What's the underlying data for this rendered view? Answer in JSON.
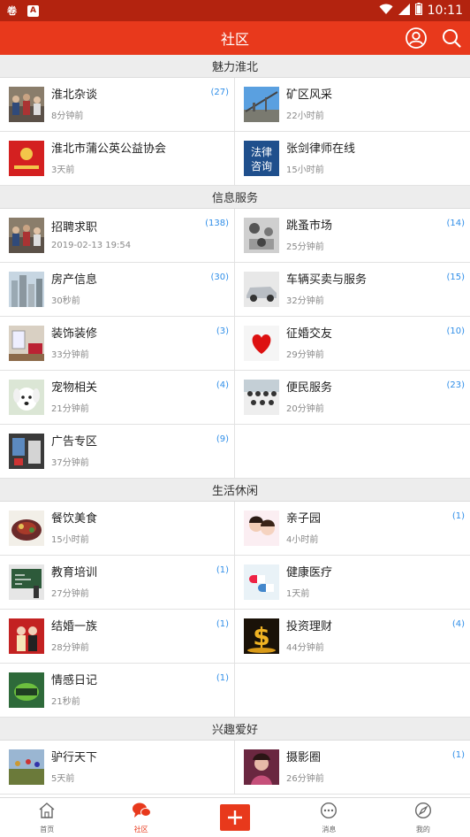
{
  "status_bar": {
    "time": "10:11",
    "app_icon_1": "卷",
    "app_icon_2": "A"
  },
  "app_bar": {
    "title": "社区"
  },
  "sections": [
    {
      "title": "魅力淮北",
      "items": [
        {
          "title": "淮北杂谈",
          "time": "8分钟前",
          "count": "(27)",
          "thumb": "crowd"
        },
        {
          "title": "矿区风采",
          "time": "22小时前",
          "count": "",
          "thumb": "sky"
        },
        {
          "title": "淮北市蒲公英公益协会",
          "time": "3天前",
          "count": "",
          "thumb": "redlogo"
        },
        {
          "title": "张剑律师在线",
          "time": "15小时前",
          "count": "",
          "thumb": "law"
        }
      ]
    },
    {
      "title": "信息服务",
      "items": [
        {
          "title": "招聘求职",
          "time": "2019-02-13 19:54",
          "count": "(138)",
          "thumb": "crowd"
        },
        {
          "title": "跳蚤市场",
          "time": "25分钟前",
          "count": "(14)",
          "thumb": "market"
        },
        {
          "title": "房产信息",
          "time": "30秒前",
          "count": "(30)",
          "thumb": "city"
        },
        {
          "title": "车辆买卖与服务",
          "time": "32分钟前",
          "count": "(15)",
          "thumb": "car"
        },
        {
          "title": "装饰装修",
          "time": "33分钟前",
          "count": "(3)",
          "thumb": "room"
        },
        {
          "title": "征婚交友",
          "time": "29分钟前",
          "count": "(10)",
          "thumb": "heart"
        },
        {
          "title": "宠物相关",
          "time": "21分钟前",
          "count": "(4)",
          "thumb": "dog"
        },
        {
          "title": "便民服务",
          "time": "20分钟前",
          "count": "(23)",
          "thumb": "group"
        },
        {
          "title": "广告专区",
          "time": "37分钟前",
          "count": "(9)",
          "thumb": "ad"
        }
      ]
    },
    {
      "title": "生活休闲",
      "items": [
        {
          "title": "餐饮美食",
          "time": "15小时前",
          "count": "",
          "thumb": "food"
        },
        {
          "title": "亲子园",
          "time": "4小时前",
          "count": "(1)",
          "thumb": "kids"
        },
        {
          "title": "教育培训",
          "time": "27分钟前",
          "count": "(1)",
          "thumb": "board"
        },
        {
          "title": "健康医疗",
          "time": "1天前",
          "count": "",
          "thumb": "pills"
        },
        {
          "title": "结婚一族",
          "time": "28分钟前",
          "count": "(1)",
          "thumb": "wedding"
        },
        {
          "title": "投资理财",
          "time": "44分钟前",
          "count": "(4)",
          "thumb": "gold"
        },
        {
          "title": "情感日记",
          "time": "21秒前",
          "count": "(1)",
          "thumb": "green"
        }
      ]
    },
    {
      "title": "兴趣爱好",
      "items": [
        {
          "title": "驴行天下",
          "time": "5天前",
          "count": "",
          "thumb": "hike"
        },
        {
          "title": "摄影圈",
          "time": "26分钟前",
          "count": "(1)",
          "thumb": "photo"
        }
      ]
    }
  ],
  "bottom_nav": [
    {
      "label": "首页",
      "icon": "home-icon"
    },
    {
      "label": "社区",
      "icon": "community-icon",
      "active": true
    },
    {
      "label": "",
      "icon": "plus-icon"
    },
    {
      "label": "消息",
      "icon": "message-icon"
    },
    {
      "label": "我的",
      "icon": "compass-icon"
    }
  ],
  "colors": {
    "accent": "#e8391c",
    "status_bar": "#b3230f",
    "count": "#2f8ee8"
  }
}
